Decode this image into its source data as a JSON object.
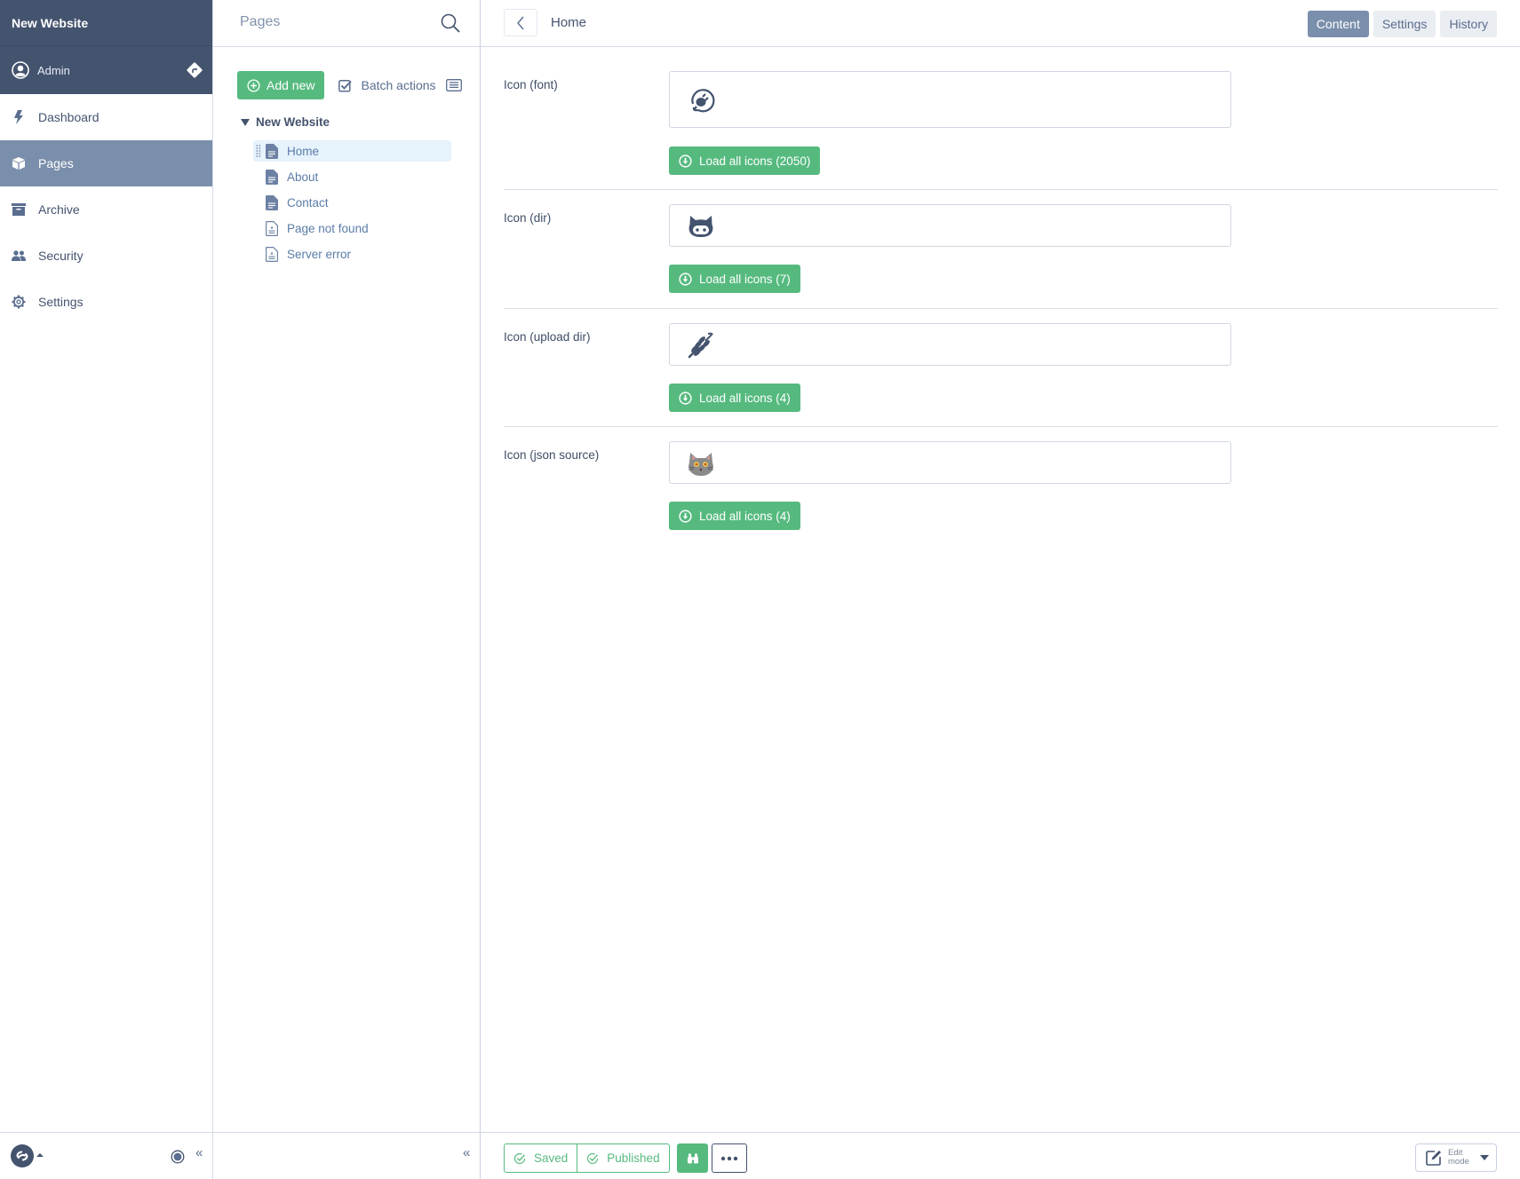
{
  "sidebar": {
    "site_title": "New Website",
    "user": {
      "name": "Admin",
      "avatar_icon": "user-circle-icon",
      "logout_icon": "logout-diamond-icon"
    },
    "items": [
      {
        "label": "Dashboard",
        "icon": "bolt-icon",
        "active": false
      },
      {
        "label": "Pages",
        "icon": "cube-icon",
        "active": true
      },
      {
        "label": "Archive",
        "icon": "archive-box-icon",
        "active": false
      },
      {
        "label": "Security",
        "icon": "users-icon",
        "active": false
      },
      {
        "label": "Settings",
        "icon": "gear-icon",
        "active": false
      }
    ],
    "footer": {
      "logo_icon": "neos-logo-icon",
      "collapse_label": "«"
    }
  },
  "pages_panel": {
    "title": "Pages",
    "add_new_label": "Add new",
    "batch_actions_label": "Batch actions",
    "tree": {
      "root": "New Website",
      "children": [
        {
          "label": "Home",
          "type": "page",
          "selected": true
        },
        {
          "label": "About",
          "type": "page",
          "selected": false
        },
        {
          "label": "Contact",
          "type": "page",
          "selected": false
        },
        {
          "label": "Page not found",
          "type": "error-page",
          "selected": false
        },
        {
          "label": "Server error",
          "type": "error-page",
          "selected": false
        }
      ]
    },
    "collapse_label": "«"
  },
  "main": {
    "breadcrumb": "Home",
    "tabs": [
      {
        "label": "Content",
        "active": true
      },
      {
        "label": "Settings",
        "active": false
      },
      {
        "label": "History",
        "active": false
      }
    ],
    "fields": [
      {
        "label": "Icon (font)",
        "value_icon": "plug-circle-icon",
        "button_label": "Load all icons (2050)"
      },
      {
        "label": "Icon (dir)",
        "value_icon": "github-cat-icon",
        "button_label": "Load all icons (7)"
      },
      {
        "label": "Icon (upload dir)",
        "value_icon": "wheat-icon",
        "button_label": "Load all icons (4)"
      },
      {
        "label": "Icon (json source)",
        "value_icon": "grey-cat-emoji-icon",
        "button_label": "Load all icons (4)"
      }
    ],
    "footer": {
      "saved_label": "Saved",
      "published_label": "Published",
      "preview_icon": "binoculars-icon",
      "more_icon": "ellipsis-icon",
      "edit_mode_label": "Edit mode"
    }
  },
  "colors": {
    "sidebar_dark": "#44536e",
    "active_item": "#7a8fab",
    "green": "#56ba7f",
    "link_blue": "#5a7ca8",
    "selected_row": "#e6f2fc"
  }
}
